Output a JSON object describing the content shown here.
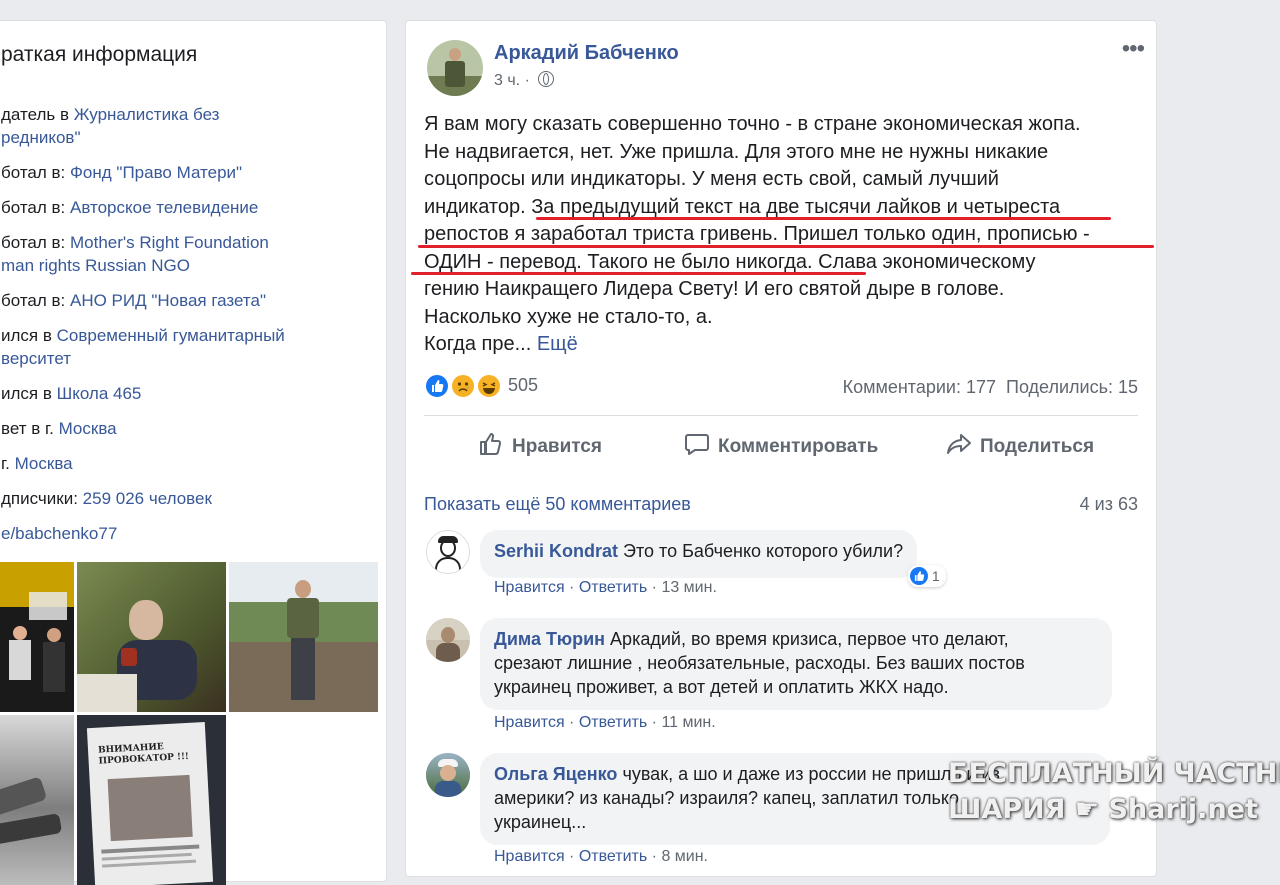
{
  "left": {
    "title": "раткая информация",
    "rows": [
      {
        "prefix": "датель в ",
        "link": "Журналистика без",
        "cont": "редников\""
      },
      {
        "prefix": "ботал в: ",
        "link": "Фонд \"Право Матери\""
      },
      {
        "prefix": "ботал в: ",
        "link": "Авторское телевидение"
      },
      {
        "prefix": "ботал в: ",
        "link": "Mother's Right Foundation",
        "cont": "man rights Russian NGO"
      },
      {
        "prefix": "ботал в: ",
        "link": "АНО РИД \"Новая газета\""
      },
      {
        "prefix": "ился в ",
        "link": "Современный гуманитарный",
        "cont": "верситет"
      },
      {
        "prefix": "ился в ",
        "link": "Школа 465"
      },
      {
        "prefix": "вет в г. ",
        "link": "Москва"
      },
      {
        "prefix": "г. ",
        "link": "Москва"
      },
      {
        "prefix": "дписчики: ",
        "link": "259 026 человек"
      },
      {
        "prefix": "",
        "link": "e/babchenko77"
      }
    ]
  },
  "post": {
    "author": "Аркадий Бабченко",
    "time": "3 ч. · ",
    "text_lines": [
      "Я вам могу сказать совершенно точно - в стране экономическая жопа.",
      "Не надвигается, нет. Уже пришла. Для этого мне не нужны никакие",
      "соцопросы или индикаторы. У меня есть свой, самый лучший",
      "индикатор. За предыдущий текст на две тысячи лайков и четыреста",
      "репостов я заработал триста гривень. Пришел только один, прописью -",
      "ОДИН - перевод. Такого не было никогда. Слава экономическому",
      "гению Наикращего Лидера Свету! И его святой дыре в голове.",
      "Насколько хуже не стало-то, а."
    ],
    "last_line_text": "Когда пре... ",
    "more_label": "Ещё",
    "reactions_count": "505",
    "comments_count": "Комментарии: 177",
    "shares_count": "Поделились: 15",
    "actions": {
      "like": "Нравится",
      "comment": "Комментировать",
      "share": "Поделиться"
    }
  },
  "comments": {
    "show_more": "Показать ещё 50 комментариев",
    "count": "4 из 63",
    "items": [
      {
        "name": "Serhii Kondrat",
        "text": "Это то Бабченко которого убили?",
        "like": "Нравится",
        "reply": "Ответить",
        "time": "13 мин.",
        "reaction_count": "1"
      },
      {
        "name": "Дима Тюрин",
        "text_line1": " Аркадий, во время кризиса, первое что делают,",
        "text_line2": "срезают лишние , необязательные, расходы. Без ваших постов",
        "text_line3": "украинец проживет, а вот детей и оплатить ЖКХ надо.",
        "like": "Нравится",
        "reply": "Ответить",
        "time": "11 мин."
      },
      {
        "name": "Ольга Яценко",
        "text_line1": " чувак, а шо и даже из россии не пришло и из",
        "text_line2": "америки? из канады? израиля? капец, заплатил только",
        "text_line3": "украинец...",
        "like": "Нравится",
        "reply": "Ответить",
        "time": "8 мин."
      }
    ]
  },
  "watermark": {
    "line1": "БЕСПЛАТНЫЙ ЧАСТНЫЙ",
    "line2a": "ШАРИЯ",
    "line2b": "Sharij.net"
  },
  "colors": {
    "link": "#385898",
    "underline": "#e0212c",
    "secondary": "#606770",
    "bubble": "#f2f3f5"
  }
}
